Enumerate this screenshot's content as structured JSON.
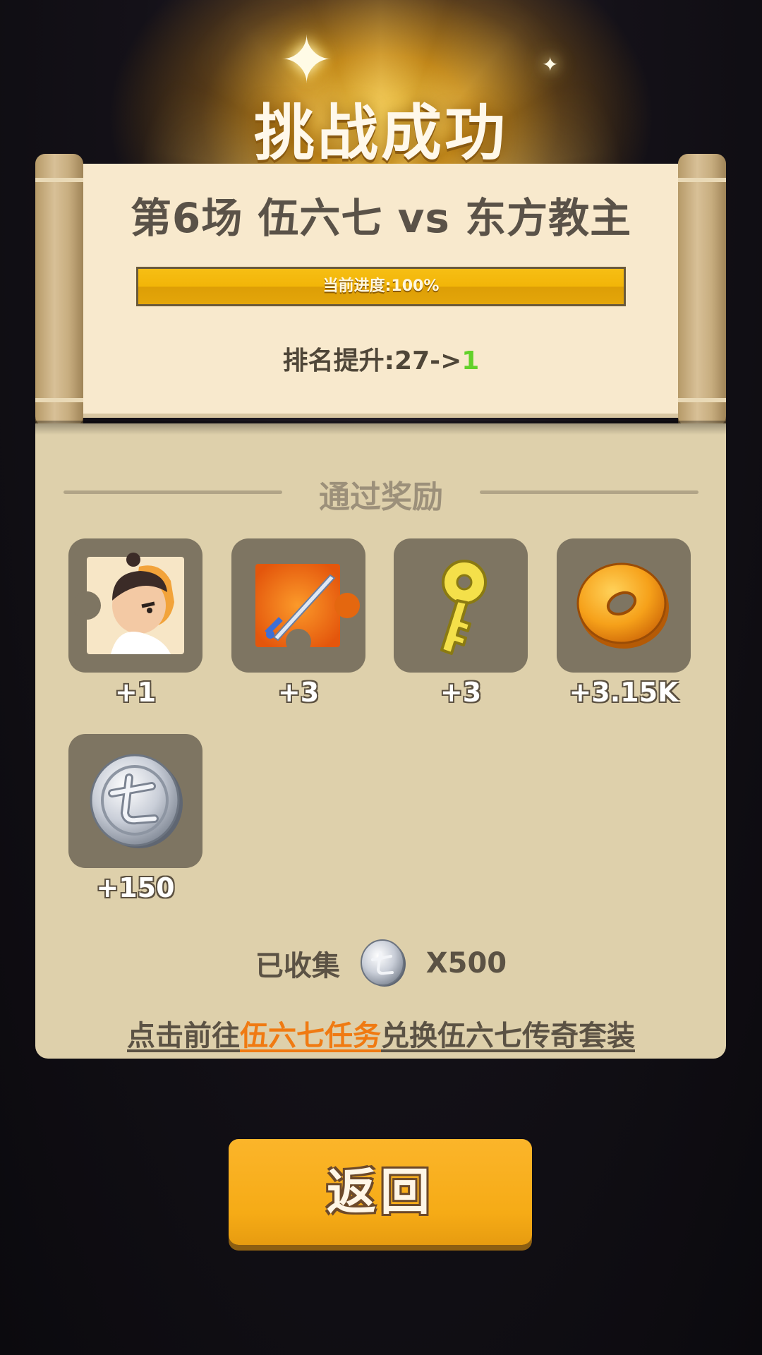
{
  "header": {
    "title": "挑战成功"
  },
  "match": {
    "title": "第6场 伍六七 vs 东方教主",
    "progress_label": "当前进度:100%",
    "progress_fraction": 1.0,
    "rank_prefix": "排名提升:27->",
    "rank_new": "1"
  },
  "rewards": {
    "section_title": "通过奖励",
    "items": [
      {
        "icon": "character-puzzle-icon",
        "amount": "+1"
      },
      {
        "icon": "sword-puzzle-icon",
        "amount": "+3"
      },
      {
        "icon": "key-icon",
        "amount": "+3"
      },
      {
        "icon": "gold-coin-icon",
        "amount": "+3.15K"
      },
      {
        "icon": "silver-seven-coin-icon",
        "amount": "+150"
      }
    ]
  },
  "collected": {
    "label": "已收集",
    "icon": "silver-seven-coin-icon",
    "count": "X500"
  },
  "link": {
    "prefix": "点击前往",
    "highlight": "伍六七任务",
    "suffix": "兑换伍六七传奇套装"
  },
  "buttons": {
    "back_label": "返回"
  },
  "colors": {
    "accent": "#f6ab16",
    "rank_green": "#62d12a",
    "link_orange": "#f07a12"
  }
}
